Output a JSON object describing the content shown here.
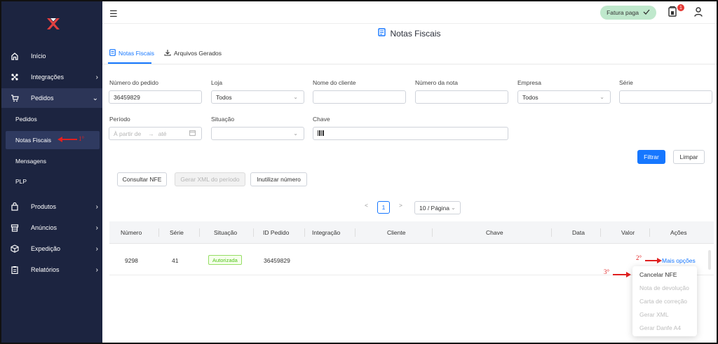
{
  "sidebar": {
    "logo_letter": "X",
    "items": [
      {
        "label": "Início",
        "icon": "home-icon"
      },
      {
        "label": "Integrações",
        "icon": "integrations-icon"
      },
      {
        "label": "Pedidos",
        "icon": "cart-icon"
      },
      {
        "label": "Produtos",
        "icon": "bag-icon"
      },
      {
        "label": "Anúncios",
        "icon": "store-icon"
      },
      {
        "label": "Expedição",
        "icon": "box-icon"
      },
      {
        "label": "Relatórios",
        "icon": "clipboard-icon"
      }
    ],
    "subitems": [
      {
        "label": "Pedidos"
      },
      {
        "label": "Notas Fiscais"
      },
      {
        "label": "Mensagens"
      },
      {
        "label": "PLP"
      }
    ]
  },
  "annotations": {
    "step1": "1°",
    "step2": "2°",
    "step3": "3°"
  },
  "header": {
    "paid_badge": "Fatura paga",
    "notification_count": "1"
  },
  "page": {
    "title": "Notas Fiscais"
  },
  "tabs": [
    {
      "label": "Notas Fiscais"
    },
    {
      "label": "Arquivos Gerados"
    }
  ],
  "filters": {
    "order_number_label": "Número do pedido",
    "order_number_value": "36459829",
    "store_label": "Loja",
    "store_value": "Todos",
    "customer_label": "Nome do cliente",
    "invoice_number_label": "Número da nota",
    "company_label": "Empresa",
    "company_value": "Todos",
    "series_label": "Série",
    "period_label": "Período",
    "period_from_placeholder": "À partir de",
    "period_arrow": "→",
    "period_to_placeholder": "até",
    "status_label": "Situação",
    "key_label": "Chave",
    "filter_button": "Filtrar",
    "clear_button": "Limpar"
  },
  "actions": {
    "consult": "Consultar NFE",
    "generate_xml": "Gerar XML do período",
    "disable_number": "Inutilizar número"
  },
  "pagination": {
    "current_page": "1",
    "page_size": "10 / Página",
    "prev": "<",
    "next": ">"
  },
  "table": {
    "columns": [
      "Número",
      "Série",
      "Situação",
      "ID Pedido",
      "Integração",
      "Cliente",
      "Chave",
      "Data",
      "Valor",
      "Ações"
    ],
    "rows": [
      {
        "numero": "9298",
        "serie": "41",
        "situacao": "Autorizada",
        "id_pedido": "36459829",
        "integracao": "",
        "cliente": "",
        "chave": "",
        "data": "",
        "valor": "",
        "acoes": "Mais opções"
      }
    ]
  },
  "dropdown": {
    "items": [
      {
        "label": "Cancelar NFE",
        "enabled": true
      },
      {
        "label": "Nota de devolução",
        "enabled": false
      },
      {
        "label": "Carta de correção",
        "enabled": false
      },
      {
        "label": "Gerar XML",
        "enabled": false
      },
      {
        "label": "Gerar Danfe A4",
        "enabled": false
      }
    ]
  },
  "colors": {
    "sidebar_bg": "#1c2440",
    "primary": "#1677ff",
    "annotation": "#e02020",
    "paid_badge_bg": "#bfe8cc"
  }
}
